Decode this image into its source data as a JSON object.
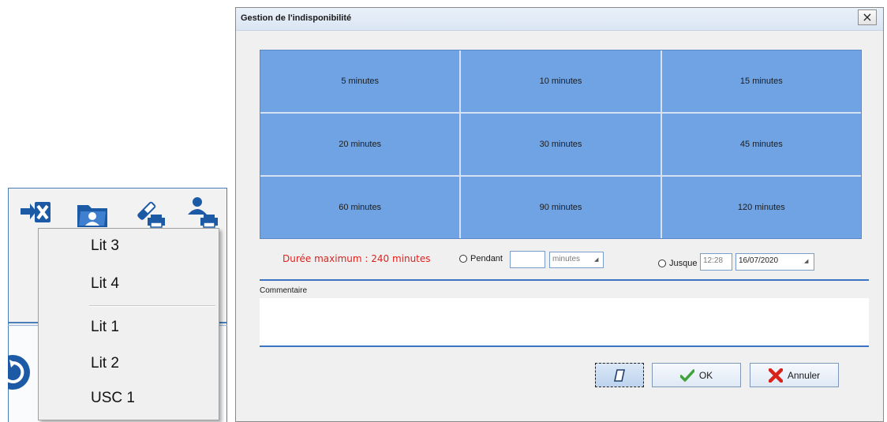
{
  "background_app": {
    "toolbar_icons": [
      "swap-close-icon",
      "patient-folder-icon",
      "pencil-print-icon",
      "user-print-icon"
    ],
    "side_icon": "refresh-icon"
  },
  "context_menu": {
    "group1": [
      "Lit 3",
      "Lit 4"
    ],
    "group2": [
      "Lit 1",
      "Lit 2",
      "USC 1"
    ]
  },
  "dialog": {
    "title": "Gestion de l'indisponibilité",
    "close_label": "×",
    "durations": [
      "5 minutes",
      "10 minutes",
      "15 minutes",
      "20 minutes",
      "30 minutes",
      "45 minutes",
      "60 minutes",
      "90 minutes",
      "120 minutes"
    ],
    "max_duration": "Durée maximum : 240 minutes",
    "pendant_label": "Pendant",
    "pendant_value": "",
    "unit_value": "minutes",
    "jusque_label": "Jusque",
    "time_value": "12:28",
    "date_value": "16/07/2020",
    "comment_label": "Commentaire",
    "comment_value": "",
    "ok_label": "OK",
    "cancel_label": "Annuler"
  },
  "colors": {
    "tile": "#6fa3e4",
    "accent": "#3b74c3",
    "error": "#e0201b",
    "ok_check": "#3fa33a",
    "cancel_x": "#d8231c"
  }
}
